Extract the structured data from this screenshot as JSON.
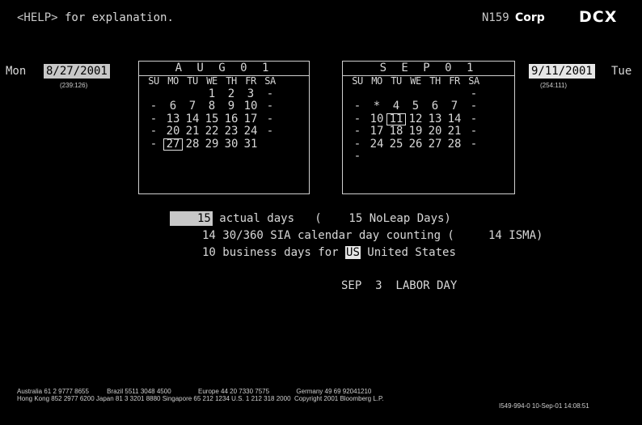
{
  "top": {
    "help_key": "<HELP>",
    "help_rest": " for explanation.",
    "screen_id": "N159",
    "corp": "Corp",
    "ticker": "DCX"
  },
  "start": {
    "day": "Mon",
    "date": "8/27/2001",
    "code": "(239:126)"
  },
  "end": {
    "day": "Tue",
    "date": "9/11/2001",
    "code": "(254:111)"
  },
  "cal_aug": {
    "title": "A U G  0 1",
    "headers": [
      "SU",
      "MO",
      "TU",
      "WE",
      "TH",
      "FR",
      "SA"
    ],
    "rows": [
      [
        "",
        "",
        "",
        "1",
        "2",
        "3",
        "-"
      ],
      [
        "-",
        "6",
        "7",
        "8",
        "9",
        "10",
        "-"
      ],
      [
        "-",
        "13",
        "14",
        "15",
        "16",
        "17",
        "-"
      ],
      [
        "-",
        "20",
        "21",
        "22",
        "23",
        "24",
        "-"
      ],
      [
        "-",
        "27",
        "28",
        "29",
        "30",
        "31",
        ""
      ]
    ]
  },
  "cal_sep": {
    "title": "S E P  0 1",
    "headers": [
      "SU",
      "MO",
      "TU",
      "WE",
      "TH",
      "FR",
      "SA"
    ],
    "rows": [
      [
        "",
        "",
        "",
        "",
        "",
        "",
        "-"
      ],
      [
        "-",
        "*",
        "4",
        "5",
        "6",
        "7",
        "-"
      ],
      [
        "-",
        "10",
        "11",
        "12",
        "13",
        "14",
        "-"
      ],
      [
        "-",
        "17",
        "18",
        "19",
        "20",
        "21",
        "-"
      ],
      [
        "-",
        "24",
        "25",
        "26",
        "27",
        "28",
        "-"
      ],
      [
        "-",
        "",
        "",
        "",
        "",
        "",
        ""
      ]
    ]
  },
  "results": {
    "actual_days": "15",
    "actual_label": " actual days   (    15 NoLeap Days)",
    "line2": "14 30/360 SIA calendar day counting (     14 ISMA)",
    "line3_pre": "10 business days for ",
    "country_code": "US",
    "line3_post": " United States",
    "holiday": "SEP  3  LABOR DAY"
  },
  "footer": {
    "line1": "Australia 61 2 9777 8655          Brazil 5511 3048 4500               Europe 44 20 7330 7575               Germany 49 69 92041210",
    "line2": "Hong Kong 852 2977 6200 Japan 81 3 3201 8880 Singapore 65 212 1234 U.S. 1 212 318 2000  Copyright 2001 Bloomberg L.P.",
    "line3": "I549-994-0 10-Sep-01 14:08:51"
  }
}
